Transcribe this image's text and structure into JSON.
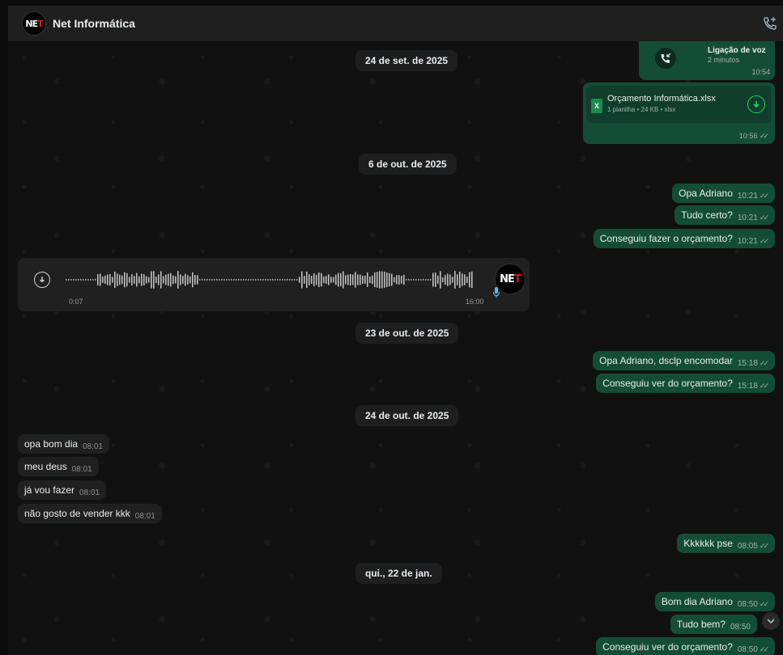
{
  "header": {
    "title": "Net Informática",
    "avatar_text": "NET"
  },
  "messages": {
    "date1": "24 de set. de 2025",
    "call": {
      "title": "Ligação de voz",
      "duration": "2 minutos",
      "time": "10:54"
    },
    "file": {
      "name": "Orçamento Informática.xlsx",
      "info": "1 planilha • 24 KB • xlsx",
      "time": "10:56",
      "icon_text": "X"
    },
    "date2": "6 de out. de 2025",
    "m1": {
      "text": "Opa Adriano",
      "time": "10:21"
    },
    "m2": {
      "text": "Tudo certo?",
      "time": "10:21"
    },
    "m3": {
      "text": "Conseguiu fazer o orçamento?",
      "time": "10:21"
    },
    "audio": {
      "duration": "0:07",
      "time": "16:00",
      "avatar_text": "NET"
    },
    "date3": "23 de out. de 2025",
    "m4": {
      "text": "Opa Adriano, dsclp encomodar",
      "time": "15:18"
    },
    "m5": {
      "text": "Conseguiu ver do orçamento?",
      "time": "15:18"
    },
    "date4": "24 de out. de 2025",
    "i1": {
      "text": "opa bom dia",
      "time": "08:01"
    },
    "i2": {
      "text": "meu deus",
      "time": "08:01"
    },
    "i3": {
      "text": "já vou fazer",
      "time": "08:01"
    },
    "i4": {
      "text": "não gosto de vender kkk",
      "time": "08:01"
    },
    "m6": {
      "text": "Kkkkkk pse",
      "time": "08:05"
    },
    "date5": "qui., 22 de jan.",
    "m7": {
      "text": "Bom dia Adriano",
      "time": "08:50"
    },
    "m8": {
      "text": "Tudo bem?",
      "time": "08:50"
    },
    "m9": {
      "text": "Conseguiu ver do orçamento?",
      "time": "08:50"
    }
  },
  "icons": {
    "call_add": "phone-plus-icon",
    "call": "phone-callback-icon",
    "download": "download-icon",
    "mic": "microphone-icon",
    "scroll_down": "chevron-down-icon",
    "read": "double-check-icon"
  },
  "colors": {
    "outgoing_bubble": "#144d37",
    "incoming_bubble": "#202020",
    "accent": "#25d366",
    "pill": "#1e1e1e"
  }
}
